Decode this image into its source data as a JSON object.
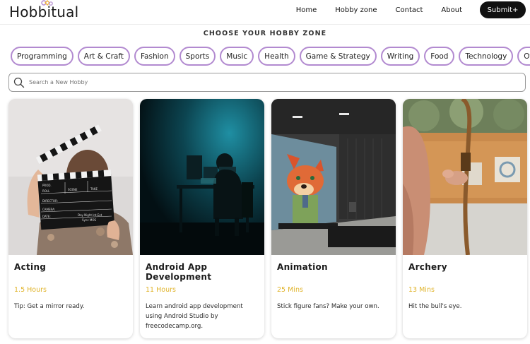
{
  "brand": {
    "name": "Hobbitual",
    "accent": "#b28ad0",
    "highlight": "#e0b42b"
  },
  "nav": {
    "items": [
      "Home",
      "Hobby zone",
      "Contact",
      "About"
    ],
    "submit_label": "Submit+"
  },
  "zone": {
    "title": "CHOOSE YOUR HOBBY ZONE",
    "categories": [
      "Programming",
      "Art & Craft",
      "Fashion",
      "Sports",
      "Music",
      "Health",
      "Game & Strategy",
      "Writing",
      "Food",
      "Technology",
      "Others"
    ]
  },
  "search": {
    "placeholder": "Search a New Hobby",
    "icon": "search-icon"
  },
  "cards": [
    {
      "title": "Acting",
      "duration": "1.5 Hours",
      "description": "Tip: Get a mirror ready.",
      "image_icon": "clapperboard-photo",
      "clapper_text": [
        "PROD.",
        "ROLL",
        "SCENE",
        "TAKE",
        "DIRECTOR:",
        "CAMERA:",
        "DATE:",
        "Day Night Int Ext",
        "Sync MOS"
      ]
    },
    {
      "title": "Android App Development",
      "duration": "11 Hours",
      "description": "Learn android app development using Android Studio by freecodecamp.org.",
      "image_icon": "developer-desk-photo"
    },
    {
      "title": "Animation",
      "duration": "25 Mins",
      "description": "Stick figure fans? Make your own.",
      "image_icon": "animated-fox-tv-photo"
    },
    {
      "title": "Archery",
      "duration": "13 Mins",
      "description": "Hit the bull's eye.",
      "image_icon": "archery-bow-photo"
    }
  ]
}
